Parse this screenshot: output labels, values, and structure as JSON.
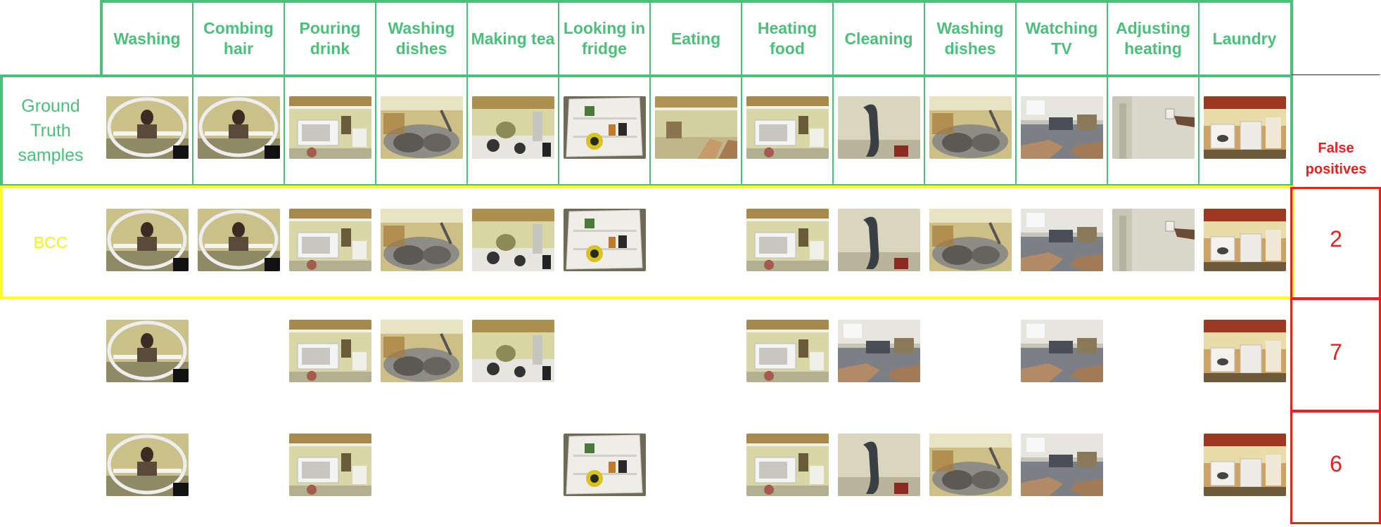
{
  "header": {
    "activities": [
      "Washing",
      "Combing hair",
      "Pouring drink",
      "Washing dishes",
      "Making tea",
      "Looking in fridge",
      "Eating",
      "Heating food",
      "Cleaning",
      "Washing dishes",
      "Watching TV",
      "Adjusting heating",
      "Laundry"
    ]
  },
  "rows": {
    "ground_truth_label": "Ground Truth samples",
    "bcc_label": "BCC",
    "false_positives_label": "False positives"
  },
  "false_positives": [
    "2",
    "7",
    "6"
  ],
  "thumbnails": {
    "ground_truth": [
      "bathroom-mirror",
      "bathroom-mirror",
      "kitchen-microwave",
      "kitchen-sink",
      "kitchen-stove",
      "fridge-interior",
      "kitchen-counter",
      "kitchen-microwave",
      "kitchen-wall",
      "kitchen-sink",
      "living-room",
      "wall-thermostat",
      "laundry-room"
    ],
    "bcc": [
      "bathroom-mirror",
      "bathroom-mirror",
      "kitchen-microwave",
      "kitchen-sink",
      "kitchen-stove",
      "fridge-interior",
      "",
      "kitchen-microwave",
      "kitchen-wall",
      "kitchen-sink",
      "living-room",
      "wall-thermostat",
      "laundry-room"
    ],
    "method_2": [
      "bathroom-mirror",
      "",
      "kitchen-microwave",
      "kitchen-sink",
      "kitchen-stove",
      "",
      "",
      "kitchen-microwave",
      "living-room",
      "",
      "living-room",
      "",
      "laundry-room"
    ],
    "method_3": [
      "bathroom-mirror",
      "",
      "kitchen-microwave",
      "",
      "",
      "fridge-interior",
      "",
      "kitchen-microwave",
      "kitchen-wall",
      "kitchen-sink",
      "living-room",
      "",
      "laundry-room"
    ]
  },
  "colors": {
    "grid": "#4cc07a",
    "bcc_highlight": "#ffff1e",
    "false_positive": "#e82020"
  }
}
